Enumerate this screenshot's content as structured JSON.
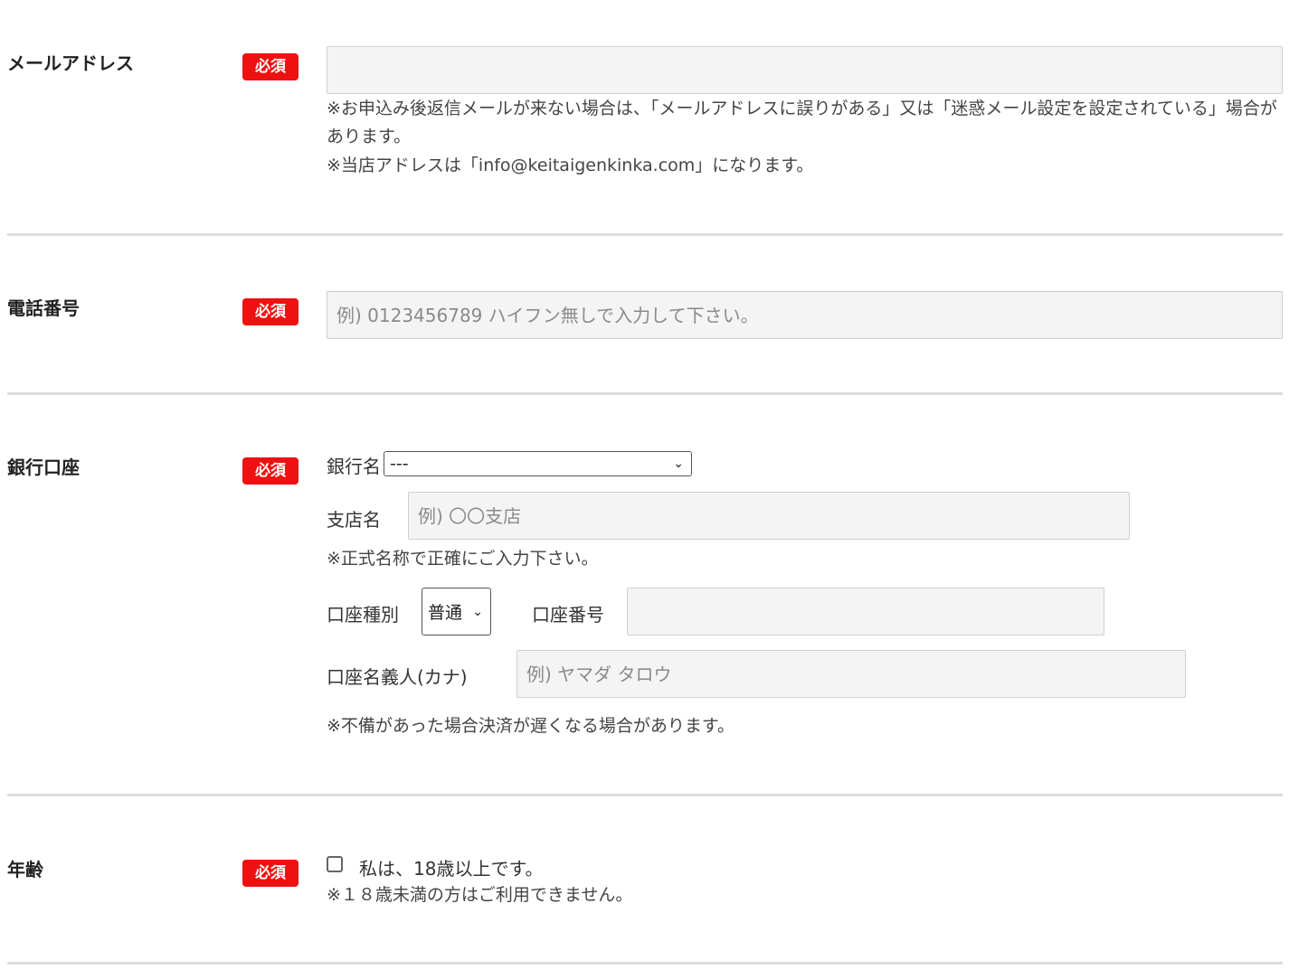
{
  "required_badge": "必須",
  "email": {
    "label": "メールアドレス",
    "value": "",
    "note1": "※お申込み後返信メールが来ない場合は、「メールアドレスに誤りがある」又は「迷惑メール設定を設定されている」場合があります。",
    "note2": "※当店アドレスは「info@keitaigenkinka.com」になります。"
  },
  "phone": {
    "label": "電話番号",
    "placeholder": "例) 0123456789 ハイフン無しで入力して下さい。"
  },
  "bank": {
    "label": "銀行口座",
    "bank_name_label": "銀行名",
    "bank_name_selected": "---",
    "branch_label": "支店名",
    "branch_placeholder": "例) 〇〇支店",
    "branch_note": "※正式名称で正確にご入力下さい。",
    "account_type_label": "口座種別",
    "account_type_selected": "普通",
    "account_number_label": "口座番号",
    "account_number_value": "",
    "holder_label": "口座名義人(カナ)",
    "holder_placeholder": "例) ヤマダ タロウ",
    "note": "※不備があった場合決済が遅くなる場合があります。"
  },
  "age": {
    "label": "年齢",
    "checkbox_label": "私は、18歳以上です。",
    "note": "※１８歳未満の方はご利用できません。"
  }
}
